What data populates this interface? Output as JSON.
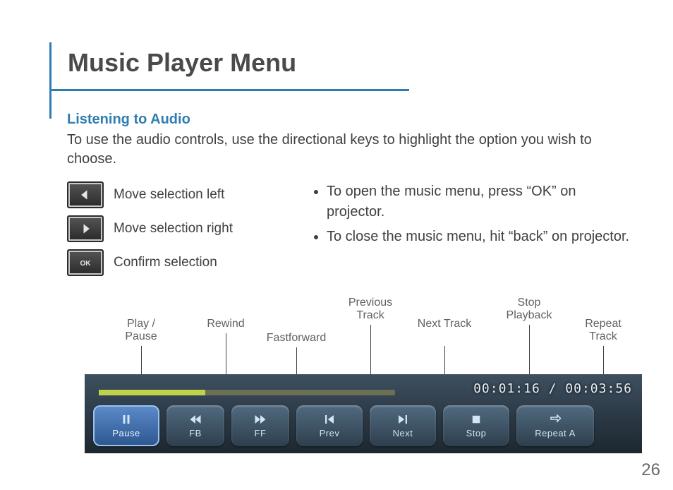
{
  "title": "Music Player Menu",
  "subhead": "Listening to Audio",
  "intro": "To use the audio controls, use the directional keys to highlight the option you wish to choose.",
  "legend": {
    "left": "Move selection left",
    "right": "Move selection right",
    "ok": "Confirm selection"
  },
  "tips": {
    "open": "To open the music menu, press “OK” on projector.",
    "close": "To close the music menu, hit “back” on projector."
  },
  "callouts": {
    "play_pause": "Play / Pause",
    "rewind": "Rewind",
    "fastforward": "Fastforward",
    "previous_track": "Previous Track",
    "next_track": "Next Track",
    "stop_playback": "Stop Playback",
    "repeat_track": "Repeat Track"
  },
  "player": {
    "time": "00:01:16 / 00:03:56",
    "buttons": {
      "pause": "Pause",
      "fb": "FB",
      "ff": "FF",
      "prev": "Prev",
      "next": "Next",
      "stop": "Stop",
      "repeat": "Repeat A"
    }
  },
  "page_number": "26"
}
